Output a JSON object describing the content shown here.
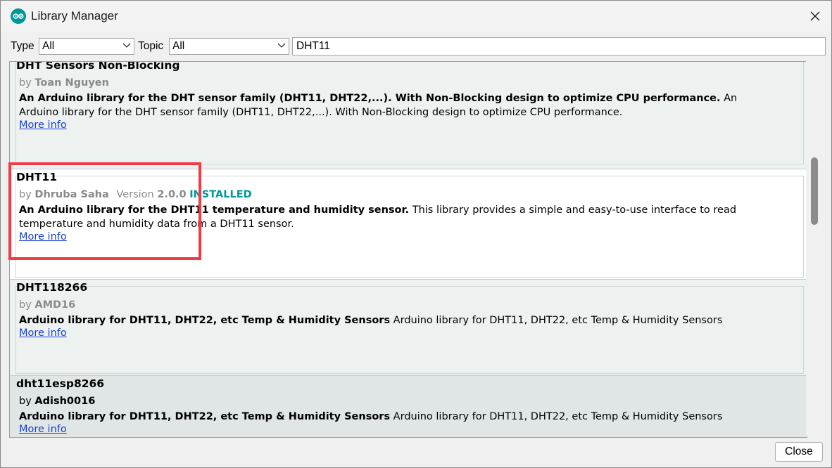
{
  "window": {
    "title": "Library Manager",
    "icon": "arduino-icon",
    "close_icon": "close-icon"
  },
  "filters": {
    "type_label": "Type",
    "type_value": "All",
    "topic_label": "Topic",
    "topic_value": "All",
    "search_value": "DHT11"
  },
  "libraries": [
    {
      "name": "DHT Sensors Non-Blocking",
      "by": "by",
      "author": "Toan Nguyen",
      "desc_bold": "An Arduino library for the DHT sensor family (DHT11, DHT22,...). With Non-Blocking design to optimize CPU performance.",
      "desc_rest": " An Arduino library for the DHT sensor family (DHT11, DHT22,...). With Non-Blocking design to optimize CPU performance.",
      "more_info": "More info"
    },
    {
      "name": "DHT11",
      "by": "by",
      "author": "Dhruba Saha",
      "version_label": "Version",
      "version": "2.0.0",
      "status": "INSTALLED",
      "desc_bold": "An Arduino library for the DHT11 temperature and humidity sensor.",
      "desc_rest": " This library provides a simple and easy-to-use interface to read temperature and humidity data from a DHT11 sensor.",
      "more_info": "More info"
    },
    {
      "name": "DHT118266",
      "by": "by",
      "author": "AMD16",
      "desc_bold": "Arduino library for DHT11, DHT22, etc Temp & Humidity Sensors",
      "desc_rest": " Arduino library for DHT11, DHT22, etc Temp & Humidity Sensors",
      "more_info": "More info"
    },
    {
      "name": "dht11esp8266",
      "by": "by",
      "author": "Adish0016",
      "desc_bold": "Arduino library for DHT11, DHT22, etc Temp & Humidity Sensors",
      "desc_rest": " Arduino library for DHT11, DHT22, etc Temp & Humidity Sensors",
      "more_info": "More info"
    }
  ],
  "footer": {
    "close_label": "Close"
  },
  "colors": {
    "accent": "#00979c",
    "highlight_box": "#ee3b44",
    "link": "#1a3fd6",
    "item_bg": "#edf2f1",
    "item_selected_bg": "#dfe6e5"
  }
}
